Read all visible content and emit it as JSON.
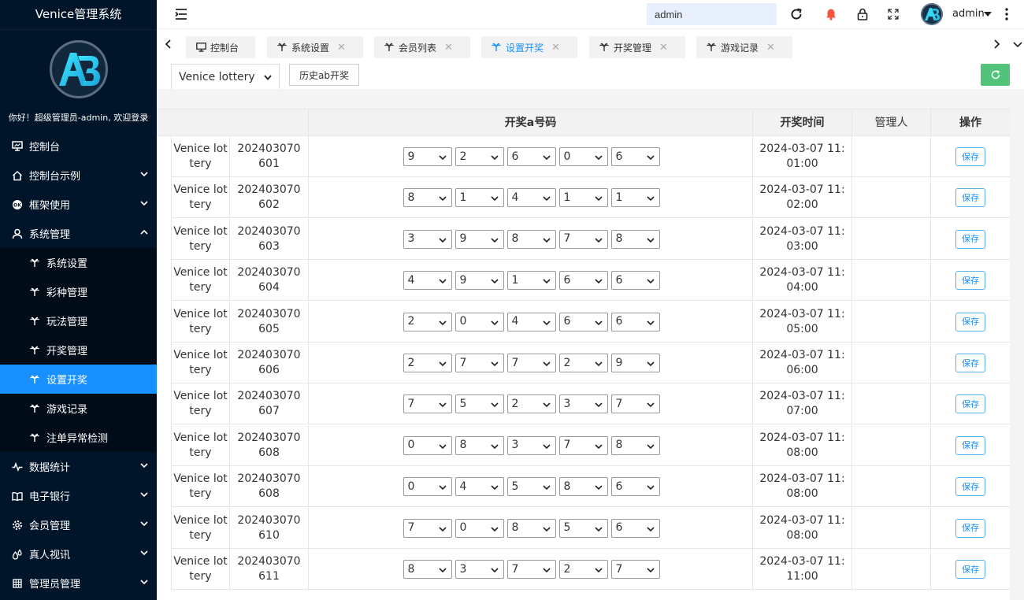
{
  "sidebar": {
    "title": "Venice管理系统",
    "welcome": "你好！超级管理员-admin, 欢迎登录",
    "items": [
      {
        "label": "控制台",
        "icon": "monitor-icon",
        "expandable": false
      },
      {
        "label": "控制台示例",
        "icon": "home-icon",
        "expandable": true
      },
      {
        "label": "框架使用",
        "icon": "ok-badge-icon",
        "expandable": true
      },
      {
        "label": "系统管理",
        "icon": "user-icon",
        "expandable": true,
        "expanded": true
      }
    ],
    "submenu": [
      {
        "label": "系统设置",
        "active": false
      },
      {
        "label": "彩种管理",
        "active": false
      },
      {
        "label": "玩法管理",
        "active": false
      },
      {
        "label": "开奖管理",
        "active": false
      },
      {
        "label": "设置开奖",
        "active": true
      },
      {
        "label": "游戏记录",
        "active": false
      },
      {
        "label": "注单异常检测",
        "active": false
      }
    ],
    "items_after": [
      {
        "label": "数据统计",
        "icon": "pulse-icon"
      },
      {
        "label": "电子银行",
        "icon": "book-icon"
      },
      {
        "label": "会员管理",
        "icon": "gear-icon"
      },
      {
        "label": "真人视讯",
        "icon": "drops-icon"
      },
      {
        "label": "管理员管理",
        "icon": "grid-icon"
      }
    ]
  },
  "topbar": {
    "search_value": "admin",
    "username": "admin"
  },
  "tabs": [
    {
      "label": "控制台",
      "closable": false,
      "active": false
    },
    {
      "label": "系统设置",
      "closable": true,
      "active": false
    },
    {
      "label": "会员列表",
      "closable": true,
      "active": false
    },
    {
      "label": "设置开奖",
      "closable": true,
      "active": true
    },
    {
      "label": "开奖管理",
      "closable": true,
      "active": false
    },
    {
      "label": "游戏记录",
      "closable": true,
      "active": false
    }
  ],
  "filter": {
    "lottery_value": "Venice lottery",
    "history_label": "历史ab开奖"
  },
  "table": {
    "headers": {
      "numbers": "开奖a号码",
      "time": "开奖时间",
      "operator": "管理人",
      "action": "操作"
    },
    "save_label": "保存",
    "rows": [
      {
        "lottery": "Venice lottery",
        "issue": "202403070601",
        "nums": [
          "9",
          "2",
          "6",
          "0",
          "6"
        ],
        "time": "2024-03-07 11:01:00"
      },
      {
        "lottery": "Venice lottery",
        "issue": "202403070602",
        "nums": [
          "8",
          "1",
          "4",
          "1",
          "1"
        ],
        "time": "2024-03-07 11:02:00"
      },
      {
        "lottery": "Venice lottery",
        "issue": "202403070603",
        "nums": [
          "3",
          "9",
          "8",
          "7",
          "8"
        ],
        "time": "2024-03-07 11:03:00"
      },
      {
        "lottery": "Venice lottery",
        "issue": "202403070604",
        "nums": [
          "4",
          "9",
          "1",
          "6",
          "6"
        ],
        "time": "2024-03-07 11:04:00"
      },
      {
        "lottery": "Venice lottery",
        "issue": "202403070605",
        "nums": [
          "2",
          "0",
          "4",
          "6",
          "6"
        ],
        "time": "2024-03-07 11:05:00"
      },
      {
        "lottery": "Venice lottery",
        "issue": "202403070606",
        "nums": [
          "2",
          "7",
          "7",
          "2",
          "9"
        ],
        "time": "2024-03-07 11:06:00"
      },
      {
        "lottery": "Venice lottery",
        "issue": "202403070607",
        "nums": [
          "7",
          "5",
          "2",
          "3",
          "7"
        ],
        "time": "2024-03-07 11:07:00"
      },
      {
        "lottery": "Venice lottery",
        "issue": "202403070608",
        "nums": [
          "0",
          "8",
          "3",
          "7",
          "8"
        ],
        "time": "2024-03-07 11:08:00"
      },
      {
        "lottery": "Venice lottery",
        "issue": "202403070608",
        "nums": [
          "0",
          "4",
          "5",
          "8",
          "6"
        ],
        "time": "2024-03-07 11:08:00"
      },
      {
        "lottery": "Venice lottery",
        "issue": "202403070610",
        "nums": [
          "7",
          "0",
          "8",
          "5",
          "6"
        ],
        "time": "2024-03-07 11:08:00"
      },
      {
        "lottery": "Venice lottery",
        "issue": "202403070611",
        "nums": [
          "8",
          "3",
          "7",
          "2",
          "7"
        ],
        "time": "2024-03-07 11:11:00"
      }
    ]
  },
  "colors": {
    "sidebar_bg": "#001529",
    "accent": "#1890ff",
    "refresh_green": "#52c47a"
  }
}
